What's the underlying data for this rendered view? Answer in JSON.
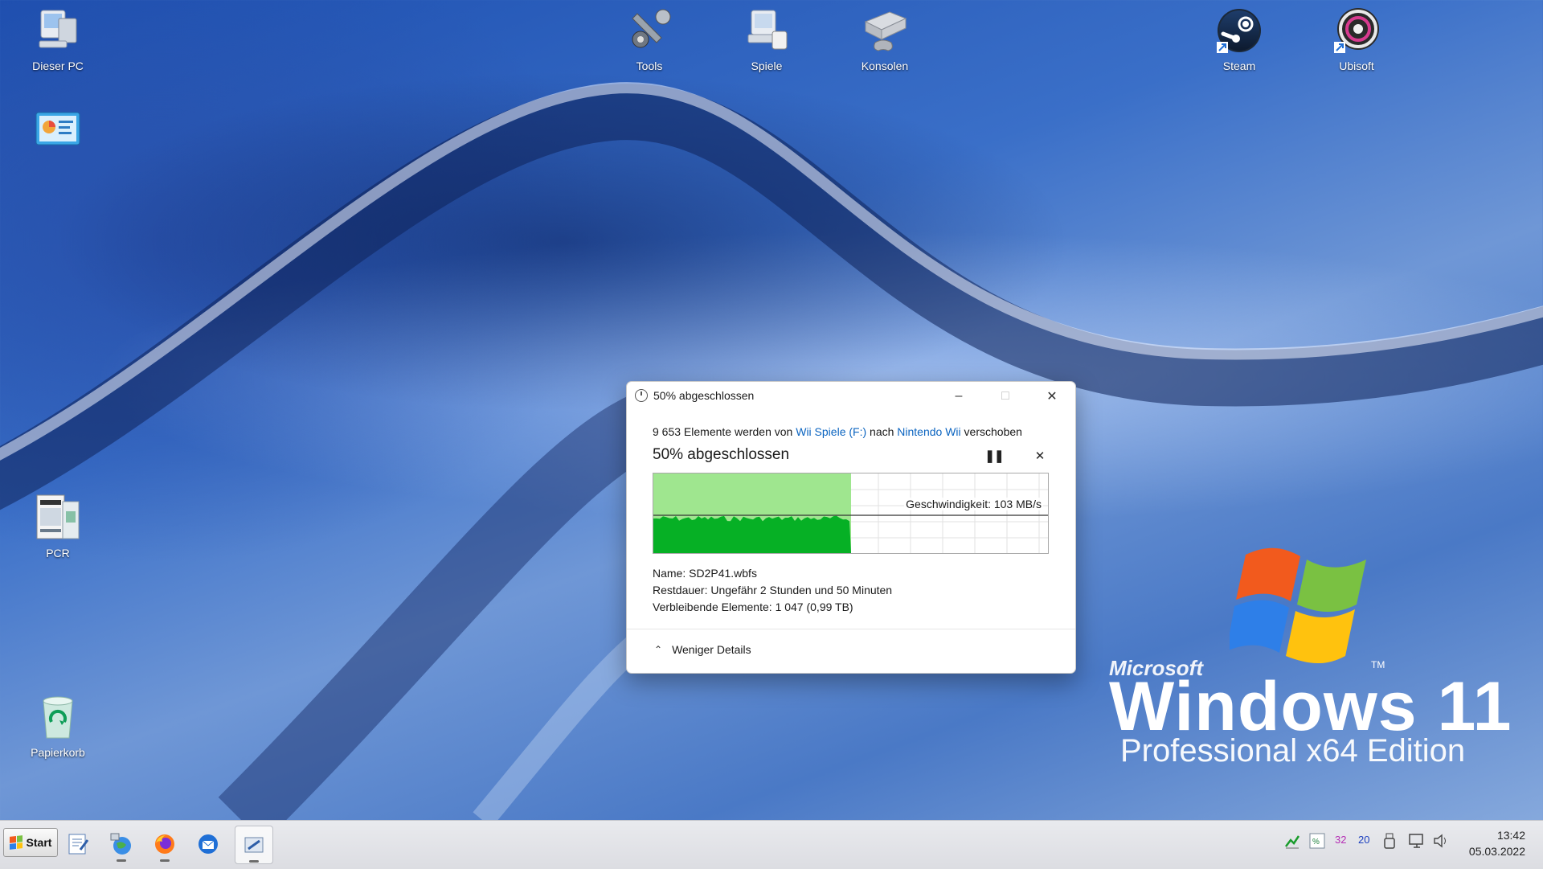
{
  "desktop": {
    "icons": [
      {
        "label": "Dieser PC"
      },
      {
        "label": ""
      },
      {
        "label": "PCR"
      },
      {
        "label": "Papierkorb"
      },
      {
        "label": "Tools"
      },
      {
        "label": "Spiele"
      },
      {
        "label": "Konsolen"
      },
      {
        "label": "Steam"
      },
      {
        "label": "Ubisoft"
      }
    ]
  },
  "wallpaper_logo": {
    "brand": "Microsoft",
    "product": "Windows 11",
    "edition": "Professional x64 Edition",
    "tm": "TM"
  },
  "dialog": {
    "title": "50% abgeschlossen",
    "info_prefix": "9 653 Elemente werden von ",
    "source": "Wii Spiele (F:)",
    "info_mid": " nach ",
    "destination": "Nintendo Wii",
    "info_suffix": " verschoben",
    "heading": "50% abgeschlossen",
    "progress_fraction": 0.5,
    "speed": "Geschwindigkeit: 103 MB/s",
    "name_label": "Name:",
    "name_value": "SD2P41.wbfs",
    "time_label": "Restdauer:",
    "time_value": "Ungefähr 2 Stunden und 50 Minuten",
    "items_label": "Verbleibende Elemente:",
    "items_value": "1 047 (0,99 TB)",
    "less_details": "Weniger Details",
    "pause_icon": "pause-icon",
    "cancel_icon": "close-icon"
  },
  "taskbar": {
    "start_label": "Start",
    "tray": {
      "n1": "32",
      "n2": "20"
    },
    "time": "13:42",
    "date": "05.03.2022"
  },
  "colors": {
    "progress_green": "#06b025",
    "progress_fill": "#9fe68f",
    "link": "#0b64c0"
  }
}
